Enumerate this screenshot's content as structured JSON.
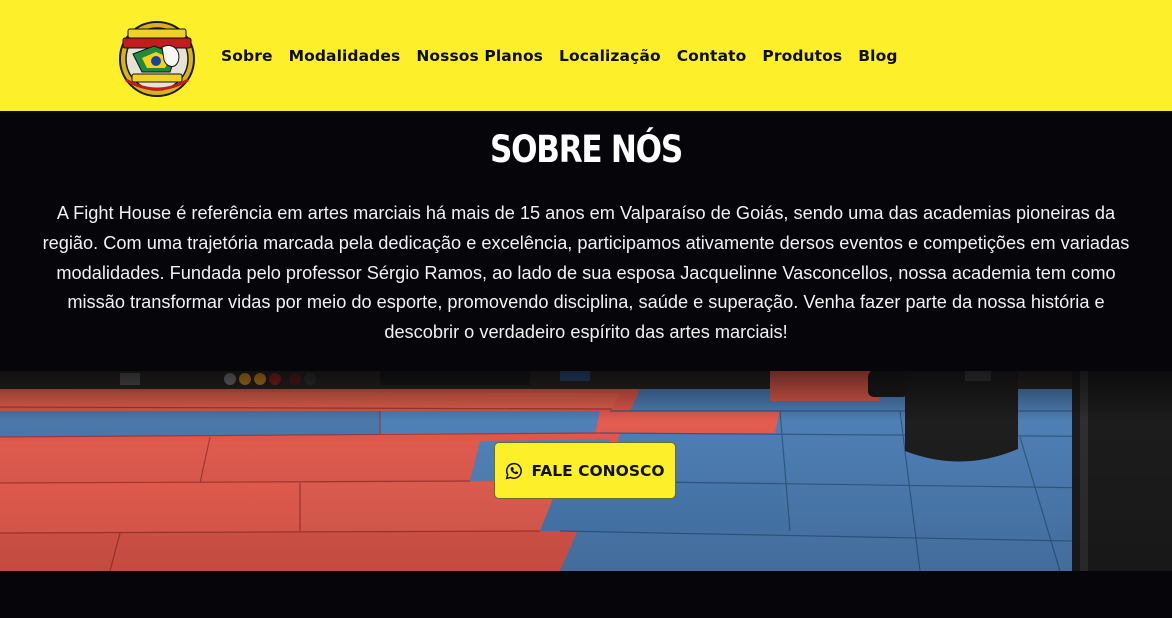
{
  "header": {
    "logo_alt": "Fight House",
    "nav": [
      "Sobre",
      "Modalidades",
      "Nossos Planos",
      "Localização",
      "Contato",
      "Produtos",
      "Blog"
    ]
  },
  "about": {
    "title": "SOBRE NÓS",
    "text": "A Fight House é referência em artes marciais há mais de 15 anos em Valparaíso de Goiás, sendo uma das academias pioneiras da região. Com uma trajetória marcada pela dedicação e excelência, participamos ativamente dersos eventos e competições em variadas modalidades. Fundada pelo professor Sérgio Ramos, ao lado de sua esposa Jacquelinne Vasconcellos, nossa academia tem como missão transformar vidas por meio do esporte, promovendo disciplina, saúde e superação. Venha fazer parte da nossa história e descobrir o verdadeiro espírito das artes marciais!"
  },
  "hero": {
    "cta_label": "FALE CONOSCO",
    "cta_icon": "whatsapp-icon"
  },
  "colors": {
    "brand_yellow": "#fdf02a",
    "dark_bg": "#05050a",
    "mat_red": "#e85a4c",
    "mat_blue": "#4f80b8"
  }
}
